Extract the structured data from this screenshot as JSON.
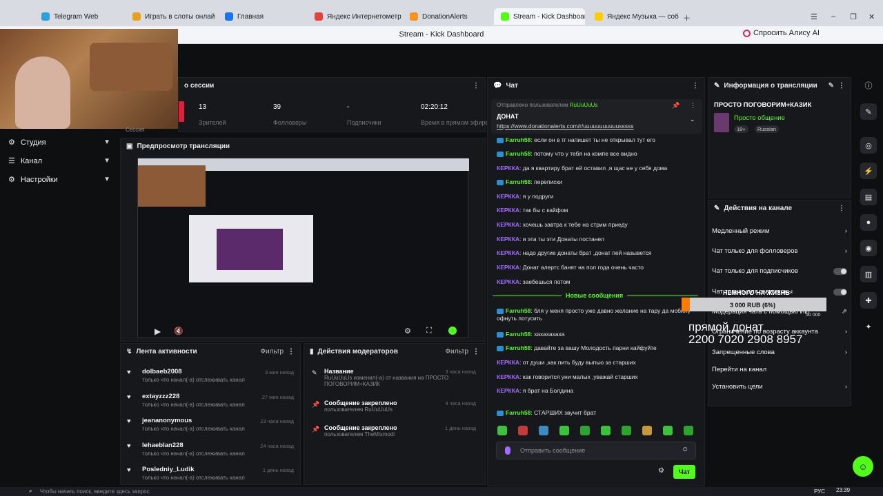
{
  "browser": {
    "tabs": [
      {
        "label": "Telegram Web",
        "color": "#2aa1da"
      },
      {
        "label": "Играть в слоты онлайн в",
        "color": "#e8a21a"
      },
      {
        "label": "Главная",
        "color": "#1a73e8"
      },
      {
        "label": "Яндекс Интернетометр –",
        "color": "#e34040"
      },
      {
        "label": "DonationAlerts",
        "color": "#f7931e"
      },
      {
        "label": "Stream - Kick Dashboar",
        "color": "#53fc18"
      },
      {
        "label": "Яндекс Музыка — собир",
        "color": "#ffcc00"
      }
    ],
    "page_title": "Stream - Kick Dashboard",
    "alice_label": "Спросить Алису AI"
  },
  "sidebar": {
    "items": [
      {
        "label": "Студия"
      },
      {
        "label": "Канал"
      },
      {
        "label": "Настройки"
      }
    ]
  },
  "session": {
    "title": "о сессии",
    "session_label": "Сессия",
    "stats": [
      {
        "value": "13",
        "label": "Зрителей"
      },
      {
        "value": "39",
        "label": "Фолловеры"
      },
      {
        "value": "-",
        "label": "Подпис­чики"
      },
      {
        "value": "02:20:12",
        "label": "Время в прямом эфире"
      }
    ]
  },
  "preview": {
    "title": "Предпросмотр трансляции"
  },
  "chat": {
    "title": "Чат",
    "pinned_by": "Отправлено пользователем",
    "pinned_user": "RuUuUuUs",
    "pinned_title": "ДОНАТ",
    "pinned_link": "https://www.donationalerts.com/r/uuuuuuuuuuusssss",
    "messages": [
      {
        "user": "Farruh58",
        "text": "если он в тг напишет ты не открывал тут его",
        "kind": "u1"
      },
      {
        "user": "Farruh58",
        "text": "потому что у тебя на компе все видно",
        "kind": "u1"
      },
      {
        "user": "КЕРККА",
        "text": "да я квартиру брат ей оставил ,я щас не у себя дома",
        "kind": "u2"
      },
      {
        "user": "Farruh58",
        "text": "переписки",
        "kind": "u1"
      },
      {
        "user": "КЕРККА",
        "text": "я у подруги",
        "kind": "u2"
      },
      {
        "user": "КЕРККА",
        "text": "так бы с кайфом",
        "kind": "u2"
      },
      {
        "user": "КЕРККА",
        "text": "хочешь завтра к тебе на стрим приеду",
        "kind": "u2"
      },
      {
        "user": "КЕРККА",
        "text": "и эта ты эти Донаты постанел",
        "kind": "u2"
      },
      {
        "user": "КЕРККА",
        "text": "надо другие донаты брат ,донат пей назывется",
        "kind": "u2"
      },
      {
        "user": "КЕРККА",
        "text": "Донат алертс банят на пол года очень часто",
        "kind": "u2"
      },
      {
        "user": "КЕРККА",
        "text": "заебешься потом",
        "kind": "u2"
      }
    ],
    "new_messages_label": "Новые сообщения",
    "messages2": [
      {
        "user": "Farruh58",
        "text": "бля у меня просто уже давно желание на тару да мобилу офнуть потусить",
        "kind": "u1"
      },
      {
        "user": "Farruh58",
        "text": "хахахахаха",
        "kind": "u1"
      },
      {
        "user": "Farruh58",
        "text": "давайте за вашу Молодость парни кайфуйте",
        "kind": "u1"
      },
      {
        "user": "КЕРККА",
        "text": "от души ,как пить буду выпью за старших",
        "kind": "u2"
      },
      {
        "user": "КЕРККА",
        "text": "как говорится уни малых ,уважай старших",
        "kind": "u2"
      },
      {
        "user": "КЕРККА",
        "text": "я брат на Болдина",
        "kind": "u2"
      },
      {
        "user": "Farruh58",
        "text": "СТАРШИХ звучит брат",
        "kind": "u1"
      }
    ],
    "input_placeholder": "Отправить сообщение",
    "send_label": "Чат"
  },
  "stream_info": {
    "title": "Информация о трансляции",
    "stream_title": "ПРОСТО ПОГОВОРИМ+КАЗИК",
    "category": "Просто общение",
    "tag1": "18+",
    "tag2": "Russian"
  },
  "channel_actions": {
    "title": "Действия на канале",
    "rows": [
      {
        "label": "Медленный режим",
        "type": "chevron"
      },
      {
        "label": "Чат только для фолловеров",
        "type": "chevron"
      },
      {
        "label": "Чат только для подписчиков",
        "type": "toggle"
      },
      {
        "label": "Чат только для эмотиконы",
        "type": "toggle"
      },
      {
        "label": "Модерация чата с помощью ИИ",
        "type": "ext"
      },
      {
        "label": "Ограничение по возрасту аккаунта",
        "type": "chevron"
      },
      {
        "label": "Запрещенные слова",
        "type": "chevron"
      },
      {
        "label": "Перейти на канал",
        "type": "none"
      },
      {
        "label": "Установить цели",
        "type": "chevron"
      }
    ]
  },
  "overlay": {
    "goal_title": "НЕМНОГО НА ЖИЗНЬ",
    "goal_value": "3 000 RUB (6%)",
    "goal_target": "50 000",
    "donate_line1": "прямой донат",
    "donate_line2": "2200 7020 2908 8957"
  },
  "activity": {
    "title": "Лента активности",
    "filter_label": "Фильтр",
    "items": [
      {
        "name": "dolbaeb2008",
        "desc": "только что начал(-а) отслеживать канал",
        "time": "3 мин назад"
      },
      {
        "name": "extayzzz228",
        "desc": "только что начал(-а) отслеживать канал",
        "time": "27 мин назад"
      },
      {
        "name": "jeananonymous",
        "desc": "только что начал(-а) отслеживать канал",
        "time": "23 часа назад"
      },
      {
        "name": "lehaeblan228",
        "desc": "только что начал(-а) отслеживать канал",
        "time": "24 часа назад"
      },
      {
        "name": "Posledniy_Ludik",
        "desc": "только что начал(-а) отслеживать канал",
        "time": "1 день назад"
      }
    ]
  },
  "mod_actions": {
    "title": "Действия модераторов",
    "filter_label": "Фильтр",
    "items": [
      {
        "title": "Название",
        "desc": "RuUuUuUs изменил(-а) от названия на ПРОСТО ПОГОВОРИМ+КАЗИК",
        "time": "3 часа назад"
      },
      {
        "title": "Сообщение закреплено",
        "desc": "пользователем RuUuUuUs",
        "time": "4 часа назад"
      },
      {
        "title": "Сообщение закреплено",
        "desc": "пользователем TheMixmodi",
        "time": "1 день назад"
      }
    ]
  },
  "taskbar": {
    "search_placeholder": "Чтобы начать поиск, введите здесь запрос",
    "lang": "РУС",
    "time": "23:39"
  }
}
